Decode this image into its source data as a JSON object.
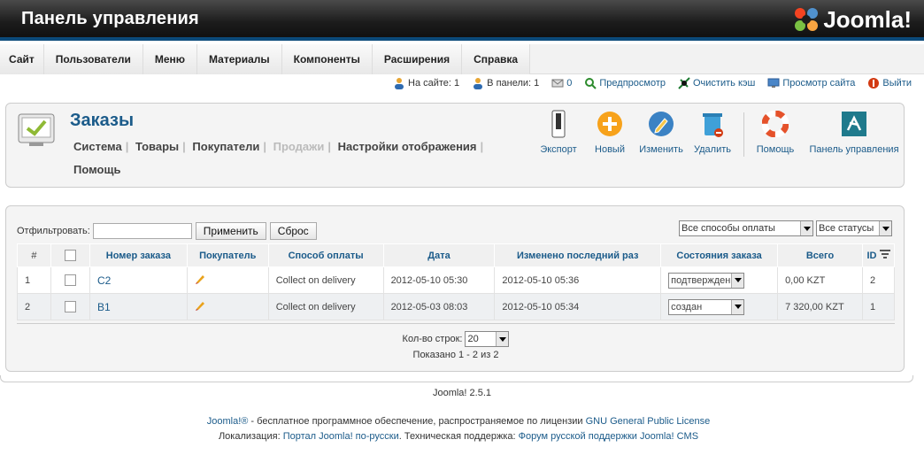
{
  "header": {
    "title": "Панель управления",
    "logo_text": "Joomla!"
  },
  "menu": [
    "Сайт",
    "Пользователи",
    "Меню",
    "Материалы",
    "Компоненты",
    "Расширения",
    "Справка"
  ],
  "status": {
    "on_site_label": "На сайте: 1",
    "in_panel_label": "В панели: 1",
    "messages": "0",
    "preview": "Предпросмотр",
    "clear_cache": "Очистить кэш",
    "view_site": "Просмотр сайта",
    "logout": "Выйти"
  },
  "page": {
    "title": "Заказы",
    "subnav": [
      {
        "label": "Система",
        "disabled": false
      },
      {
        "label": "Товары",
        "disabled": false
      },
      {
        "label": "Покупатели",
        "disabled": false
      },
      {
        "label": "Продажи",
        "disabled": true
      },
      {
        "label": "Настройки отображения",
        "disabled": false
      },
      {
        "label": "Помощь",
        "disabled": false
      }
    ]
  },
  "toolbar": {
    "export": "Экспорт",
    "new": "Новый",
    "edit": "Изменить",
    "delete": "Удалить",
    "help": "Помощь",
    "cpanel": "Панель управления"
  },
  "filter": {
    "label": "Отфильтровать:",
    "value": "",
    "apply": "Применить",
    "reset": "Сброс",
    "payment_select": "Все способы оплаты",
    "status_select": "Все статусы"
  },
  "table": {
    "headers": [
      "#",
      "",
      "Номер заказа",
      "Покупатель",
      "Способ оплаты",
      "Дата",
      "Изменено последний раз",
      "Состояния заказа",
      "Всего",
      "ID"
    ],
    "rows": [
      {
        "num": "1",
        "order": "C2",
        "payment": "Collect on delivery",
        "date": "2012-05-10 05:30",
        "modified": "2012-05-10 05:36",
        "status": "подтвержден",
        "total": "0,00 KZT",
        "id": "2"
      },
      {
        "num": "2",
        "order": "B1",
        "payment": "Collect on delivery",
        "date": "2012-05-03 08:03",
        "modified": "2012-05-10 05:34",
        "status": "создан",
        "total": "7 320,00 KZT",
        "id": "1"
      }
    ]
  },
  "pagination": {
    "rows_label": "Кол-во строк:",
    "rows_value": "20",
    "shown": "Показано 1 - 2 из 2"
  },
  "footer": {
    "version": "Joomla! 2.5.1",
    "line1_link": "Joomla!®",
    "line1_text": " - бесплатное программное обеспечение, распространяемое по лицензии ",
    "line1_license": "GNU General Public License",
    "line2_label": "Локализация: ",
    "line2_link1": "Портал Joomla! по-русски",
    "line2_text": ". Техническая поддержка: ",
    "line2_link2": "Форум русской поддержки Joomla! CMS"
  },
  "colors": {
    "accent": "#1b5b8a",
    "header_bg": "#1c1c1c",
    "header_border": "#0b4a7a"
  }
}
